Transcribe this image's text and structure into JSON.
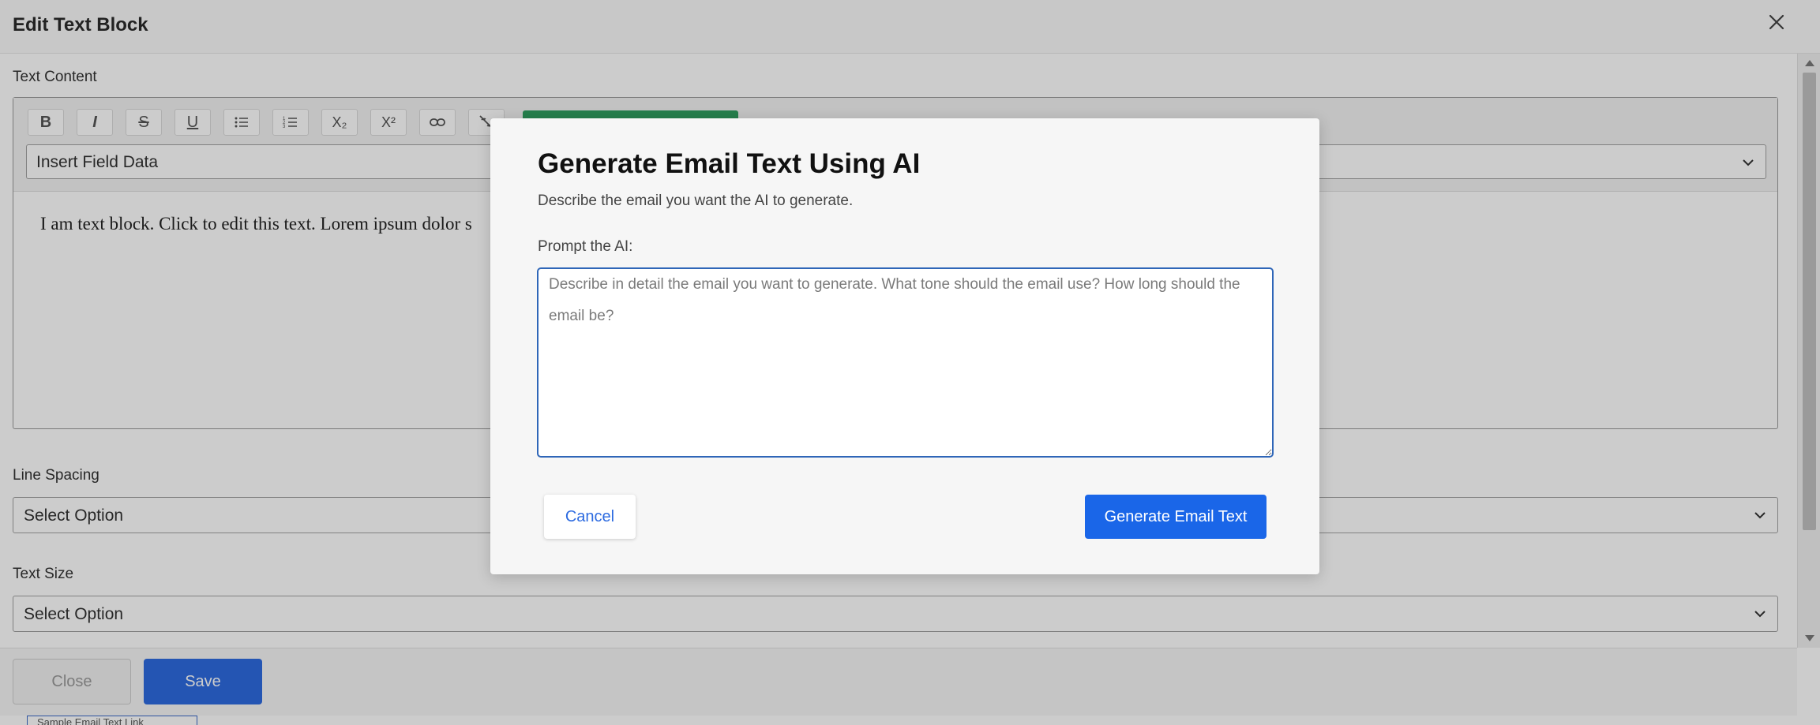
{
  "panel": {
    "title": "Edit Text Block",
    "text_content_label": "Text Content",
    "toolbar": {
      "buttons": [
        {
          "name": "bold",
          "glyph": "B"
        },
        {
          "name": "italic",
          "glyph": "I"
        },
        {
          "name": "strikethrough",
          "glyph": "S"
        },
        {
          "name": "underline",
          "glyph": "U"
        },
        {
          "name": "bullet-list",
          "glyph": ""
        },
        {
          "name": "numbered-list",
          "glyph": ""
        },
        {
          "name": "subscript",
          "glyph": "X₂"
        },
        {
          "name": "superscript",
          "glyph": "X²"
        },
        {
          "name": "link",
          "glyph": ""
        },
        {
          "name": "unlink",
          "glyph": ""
        }
      ],
      "insert_field_value": "Insert Field Data"
    },
    "editor_text": "I am text block. Click to edit this text. Lorem ipsum dolor s",
    "line_spacing_label": "Line Spacing",
    "line_spacing_value": "Select Option",
    "text_size_label": "Text Size",
    "text_size_value": "Select Option",
    "close_button": "Close",
    "save_button": "Save",
    "below_tab_text": "Sample Email Text Link"
  },
  "modal": {
    "title": "Generate Email Text Using AI",
    "subtitle": "Describe the email you want the AI to generate.",
    "prompt_label": "Prompt the AI:",
    "prompt_placeholder": "Describe in detail the email you want to generate. What tone should the email use? How long should the email be?",
    "prompt_value": "",
    "cancel_button": "Cancel",
    "generate_button": "Generate Email Text"
  },
  "colors": {
    "primary": "#1a66e8",
    "save": "#2d6be0",
    "ai_button": "#2f9e5f",
    "focus_border": "#2f66b8"
  }
}
